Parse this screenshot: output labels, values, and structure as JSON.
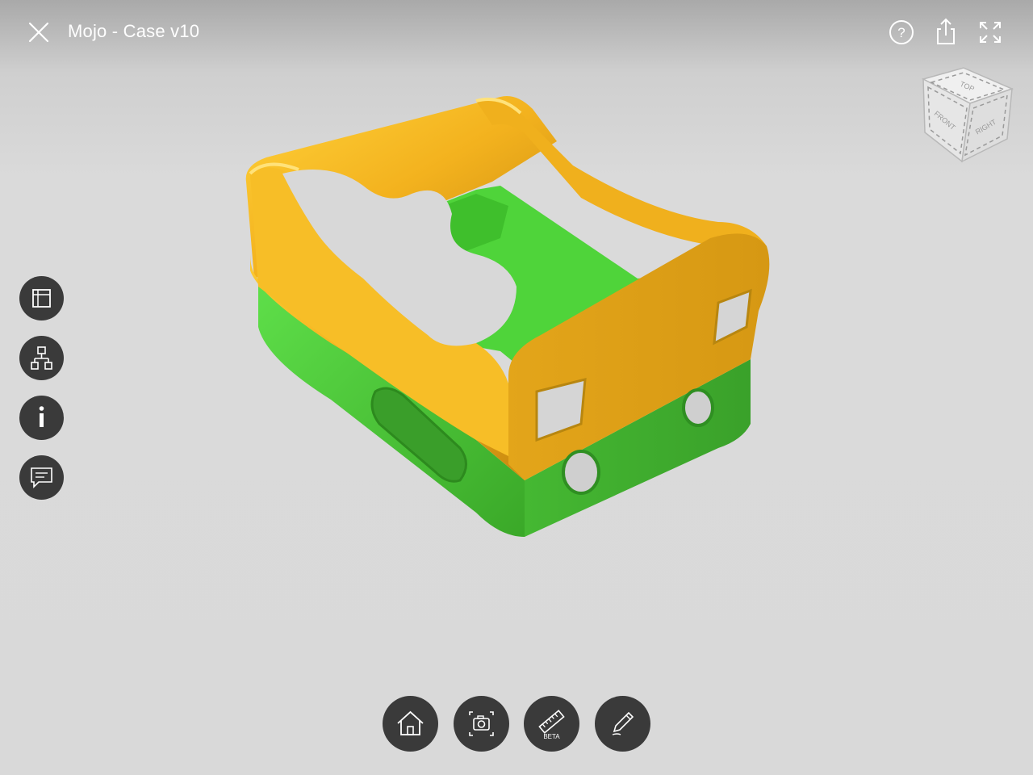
{
  "header": {
    "title": "Mojo - Case v10"
  },
  "view_cube": {
    "top_label": "TOP",
    "front_label": "FRONT",
    "right_label": "RIGHT"
  },
  "sidebar": {
    "items": [
      {
        "name": "model-browser",
        "icon": "panel-icon"
      },
      {
        "name": "structure",
        "icon": "hierarchy-icon"
      },
      {
        "name": "info",
        "icon": "info-icon"
      },
      {
        "name": "comments",
        "icon": "comment-icon"
      }
    ]
  },
  "toolbar": {
    "items": [
      {
        "name": "home",
        "icon": "home-icon"
      },
      {
        "name": "snapshot",
        "icon": "camera-icon"
      },
      {
        "name": "measure",
        "icon": "ruler-icon",
        "badge": "BETA"
      },
      {
        "name": "markup",
        "icon": "pencil-icon"
      }
    ]
  },
  "colors": {
    "top_shell": "#f5b720",
    "bottom_shell": "#4fcf3a",
    "button_bg": "#3a3a3a"
  }
}
